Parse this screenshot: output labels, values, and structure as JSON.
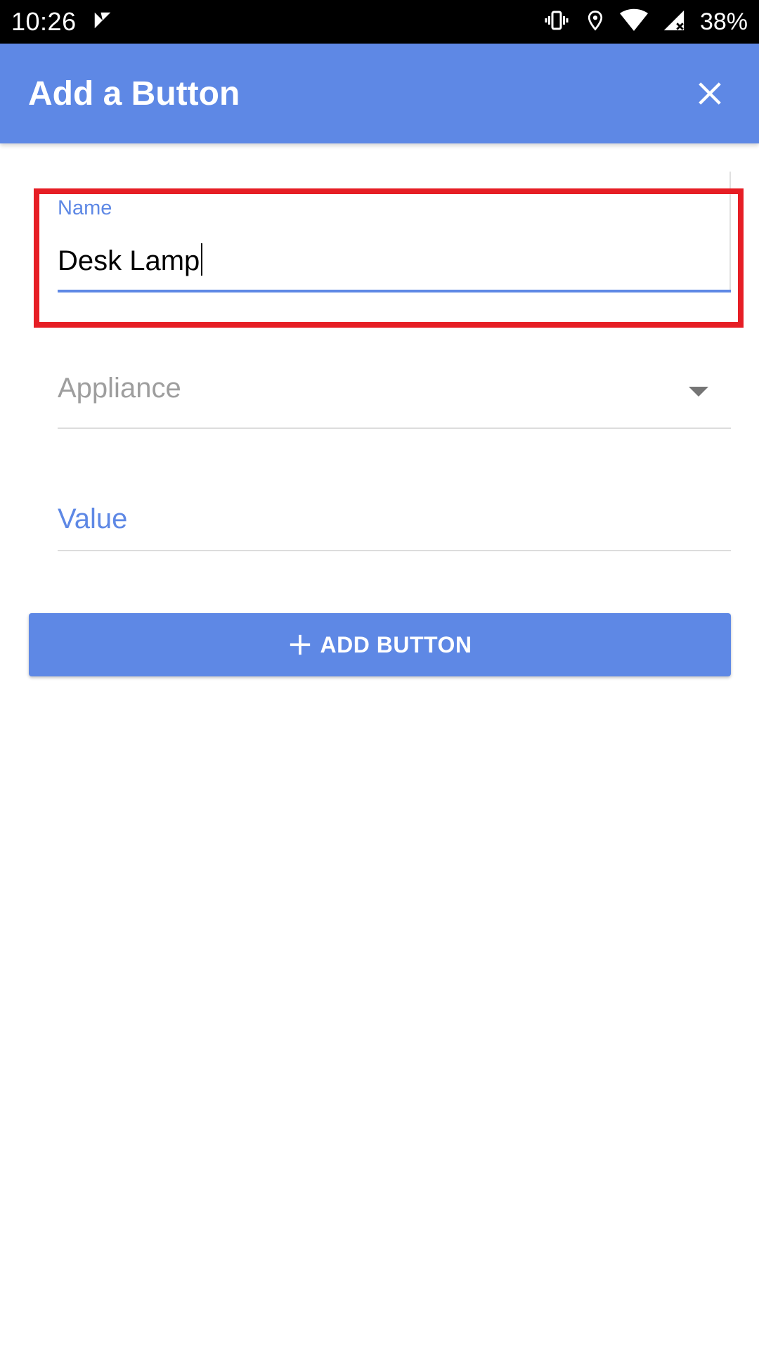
{
  "status_bar": {
    "time": "10:26",
    "battery": "38%"
  },
  "app_bar": {
    "title": "Add a Button"
  },
  "form": {
    "name": {
      "label": "Name",
      "value": "Desk Lamp"
    },
    "appliance": {
      "placeholder": "Appliance"
    },
    "value": {
      "label": "Value"
    }
  },
  "actions": {
    "add_button_label": "ADD BUTTON"
  },
  "colors": {
    "primary": "#5e88e5",
    "highlight": "#e61e25"
  },
  "icons": {
    "close": "close-icon",
    "dropdown": "chevron-down-icon",
    "add": "plus-icon"
  }
}
